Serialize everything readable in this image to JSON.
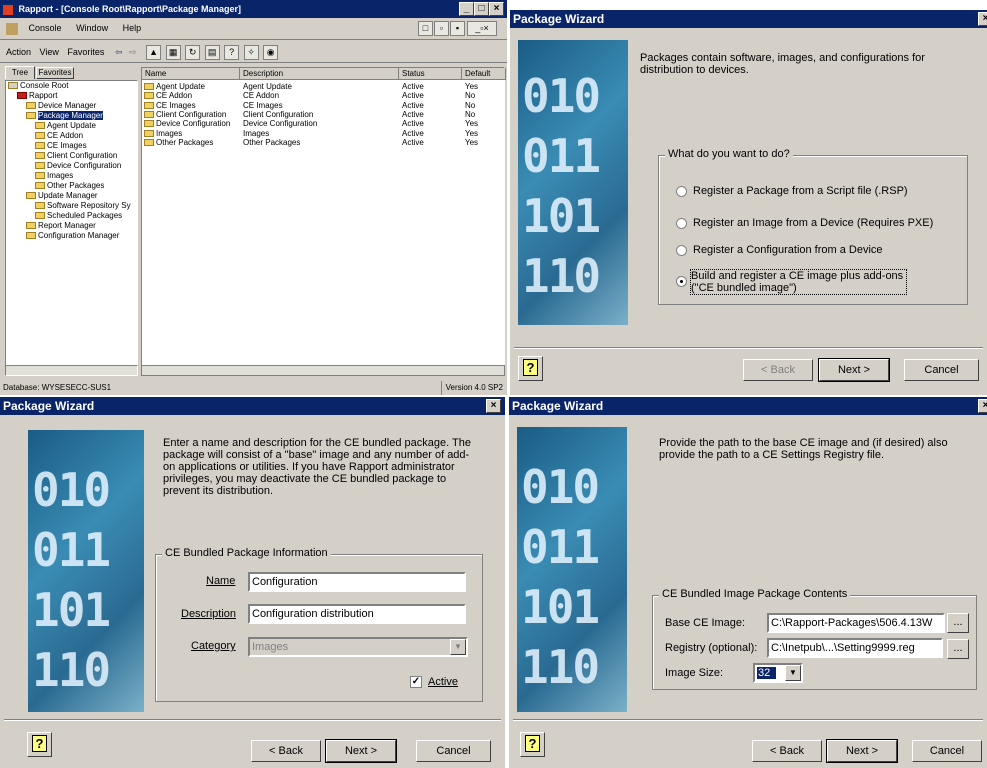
{
  "mmc": {
    "title": "Rapport - [Console Root\\Rapport\\Package Manager]",
    "menus": [
      "Console",
      "Window",
      "Help"
    ],
    "toolbar_menus": [
      "Action",
      "View",
      "Favorites"
    ],
    "tabs": [
      "Tree",
      "Favorites"
    ],
    "tree": [
      {
        "label": "Console Root",
        "indent": 0
      },
      {
        "label": "Rapport",
        "indent": 1
      },
      {
        "label": "Device Manager",
        "indent": 2
      },
      {
        "label": "Package Manager",
        "indent": 2,
        "selected": true
      },
      {
        "label": "Agent Update",
        "indent": 3
      },
      {
        "label": "CE Addon",
        "indent": 3
      },
      {
        "label": "CE Images",
        "indent": 3
      },
      {
        "label": "Client Configuration",
        "indent": 3
      },
      {
        "label": "Device Configuration",
        "indent": 3
      },
      {
        "label": "Images",
        "indent": 3
      },
      {
        "label": "Other Packages",
        "indent": 3
      },
      {
        "label": "Update Manager",
        "indent": 2
      },
      {
        "label": "Software Repository Sy",
        "indent": 3
      },
      {
        "label": "Scheduled Packages",
        "indent": 3
      },
      {
        "label": "Report Manager",
        "indent": 2
      },
      {
        "label": "Configuration Manager",
        "indent": 2
      }
    ],
    "columns": [
      "Name",
      "Description",
      "Status",
      "Default"
    ],
    "rows": [
      [
        "Agent Update",
        "Agent Update",
        "Active",
        "Yes"
      ],
      [
        "CE Addon",
        "CE Addon",
        "Active",
        "No"
      ],
      [
        "CE Images",
        "CE Images",
        "Active",
        "No"
      ],
      [
        "Client Configuration",
        "Client Configuration",
        "Active",
        "No"
      ],
      [
        "Device Configuration",
        "Device Configuration",
        "Active",
        "Yes"
      ],
      [
        "Images",
        "Images",
        "Active",
        "Yes"
      ],
      [
        "Other Packages",
        "Other Packages",
        "Active",
        "Yes"
      ]
    ],
    "status_left": "Database: WYSESECC-SUS1",
    "status_right": "Version 4.0 SP2"
  },
  "wizard1": {
    "title": "Package Wizard",
    "intro": "Packages contain software, images, and configurations for distribution to devices.",
    "group_label": "What do you want to do?",
    "options": [
      "Register a Package from a Script file (.RSP)",
      "Register an Image from a Device (Requires PXE)",
      "Register a Configuration from a Device",
      "Build and register a CE image plus add-ons (\"CE bundled image\")"
    ],
    "back": "< Back",
    "next": "Next >",
    "cancel": "Cancel"
  },
  "wizard2": {
    "title": "Package Wizard",
    "intro": "Enter a name and description for the CE bundled package. The package will consist of a \"base\" image and any number of add-on applications or utilities. If you have Rapport administrator privileges, you may deactivate the CE bundled package to prevent its distribution.",
    "group_label": "CE Bundled Package Information",
    "name_label": "Name",
    "name_value": "Configuration",
    "desc_label": "Description",
    "desc_value": "Configuration distribution",
    "cat_label": "Category",
    "cat_value": "Images",
    "active_label": "Active",
    "back": "< Back",
    "next": "Next >",
    "cancel": "Cancel"
  },
  "wizard3": {
    "title": "Package Wizard",
    "intro": "Provide the path to the base CE image and (if desired) also provide the path to a CE Settings Registry file.",
    "group_label": "CE Bundled Image Package Contents",
    "base_label": "Base CE Image:",
    "base_value": "C:\\Rapport-Packages\\506.4.13W",
    "reg_label": "Registry (optional):",
    "reg_value": "C:\\Inetpub\\...\\Setting9999.reg",
    "size_label": "Image Size:",
    "size_value": "32",
    "browse": "...",
    "back": "< Back",
    "next": "Next >",
    "cancel": "Cancel"
  },
  "art_lines": [
    "010",
    "011",
    "101",
    "110"
  ]
}
